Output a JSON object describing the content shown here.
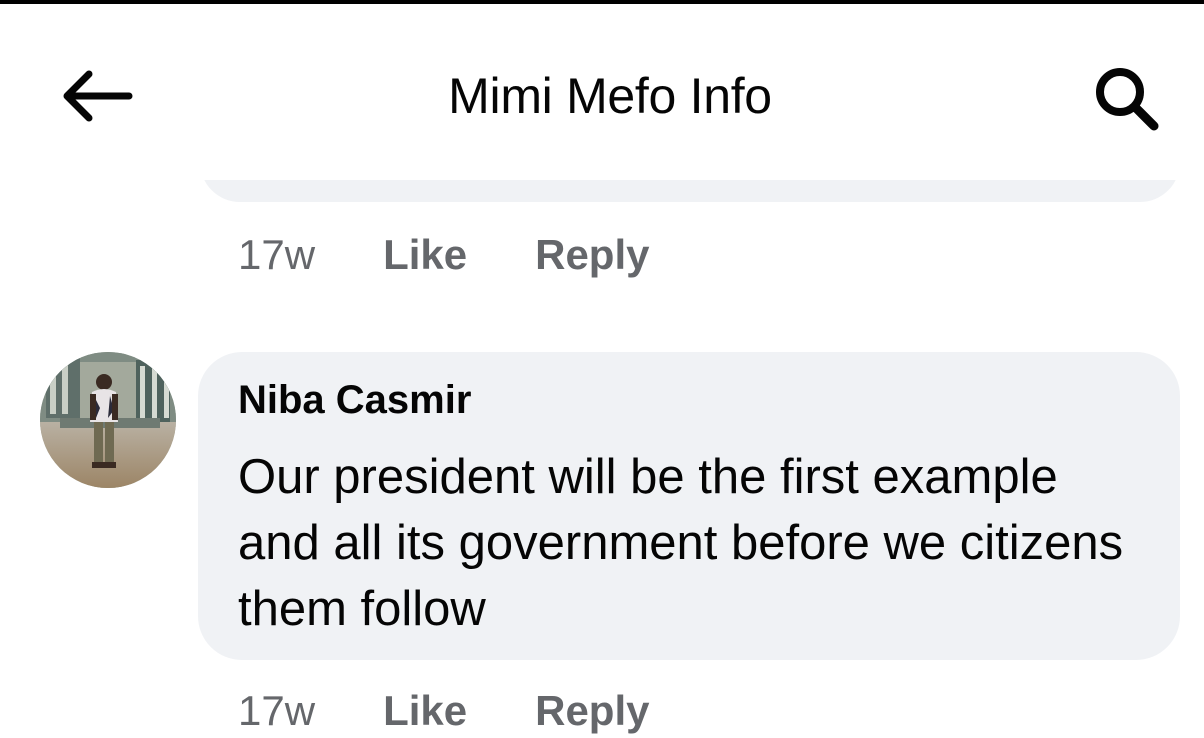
{
  "header": {
    "title": "Mimi Mefo Info",
    "back_icon": "arrow-left-icon",
    "search_icon": "search-icon"
  },
  "previous_comment": {
    "time": "17w",
    "like_label": "Like",
    "reply_label": "Reply"
  },
  "comment": {
    "author": "Niba Casmir",
    "text": "Our president will be the first example and all its government before we citizens them follow",
    "time": "17w",
    "like_label": "Like",
    "reply_label": "Reply"
  },
  "colors": {
    "bubble_bg": "#f0f2f5",
    "secondary_text": "#65676b",
    "primary_text": "#050505"
  }
}
